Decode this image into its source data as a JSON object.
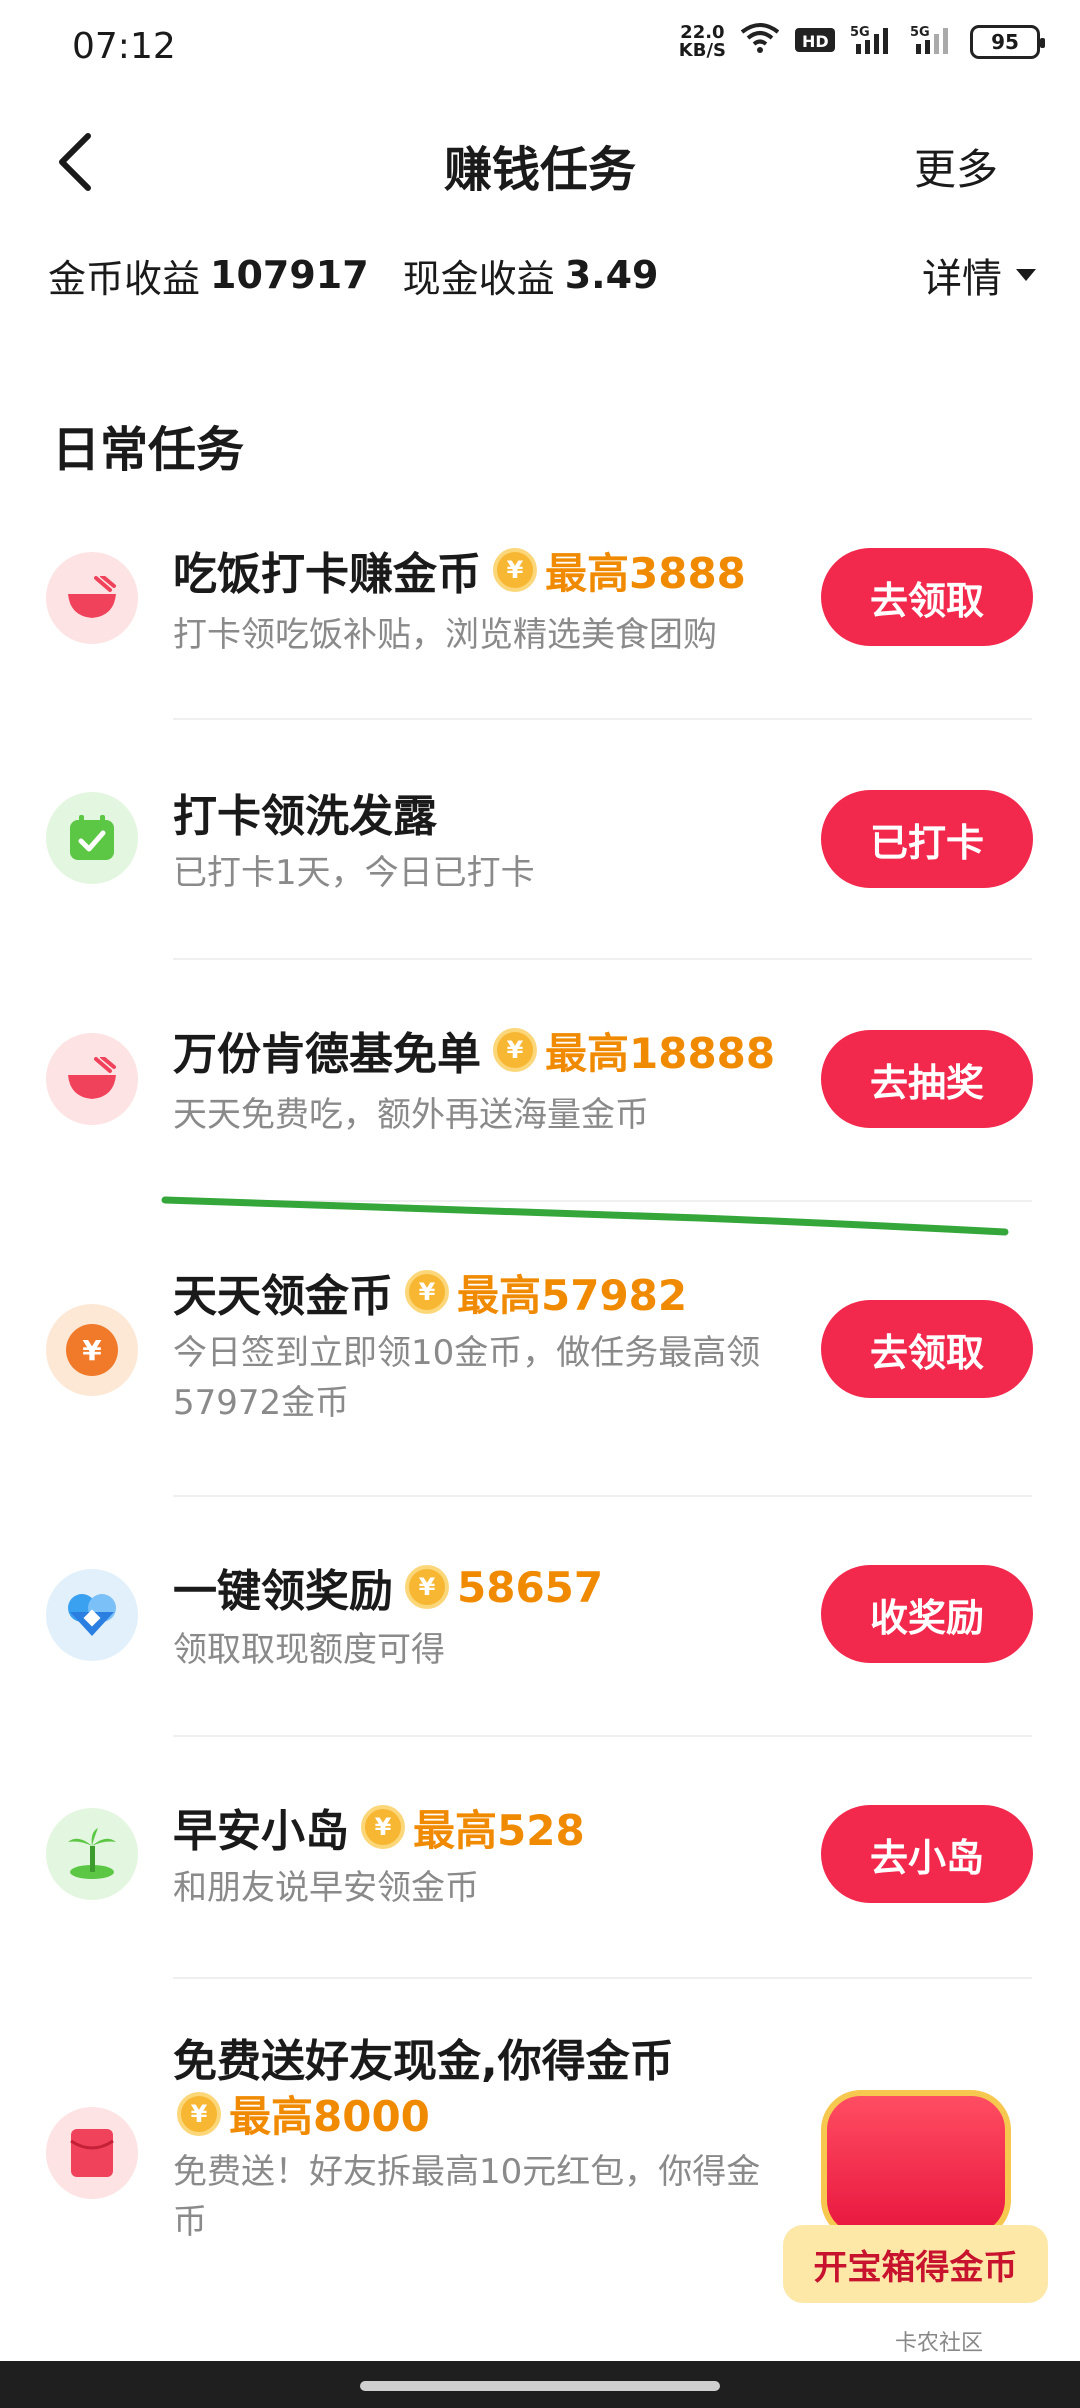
{
  "status_bar": {
    "time": "07:12",
    "net_speed_value": "22.0",
    "net_speed_unit": "KB/S",
    "battery": "95"
  },
  "header": {
    "title": "赚钱任务",
    "more": "更多"
  },
  "earnings": {
    "coin_label": "金币收益",
    "coin_value": "107917",
    "cash_label": "现金收益",
    "cash_value": "3.49",
    "detail": "详情"
  },
  "section_title": "日常任务",
  "tasks": [
    {
      "title": "吃饭打卡赚金币",
      "max": "最高3888",
      "desc": "打卡领吃饭补贴，浏览精选美食团购",
      "button": "去领取",
      "icon": "bowl-icon",
      "icon_bg": "#fde3e3"
    },
    {
      "title": "打卡领洗发露",
      "max": "",
      "desc": "已打卡1天，今日已打卡",
      "button": "已打卡",
      "icon": "calendar-check-icon",
      "icon_bg": "#e3f6df"
    },
    {
      "title": "万份肯德基免单",
      "max": "最高18888",
      "desc": "天天免费吃，额外再送海量金币",
      "button": "去抽奖",
      "icon": "bowl-icon",
      "icon_bg": "#fde3e3"
    },
    {
      "title": "天天领金币",
      "max": "最高57982",
      "desc": "今日签到立即领10金币，做任务最高领57972金币",
      "button": "去领取",
      "icon": "yen-coin-icon",
      "icon_bg": "#fde8d6"
    },
    {
      "title": "一键领奖励",
      "max": "58657",
      "desc": "领取取现额度可得",
      "button": "收奖励",
      "icon": "diamond-icon",
      "icon_bg": "#e1f0fb"
    },
    {
      "title": "早安小岛",
      "max": "最高528",
      "desc": "和朋友说早安领金币",
      "button": "去小岛",
      "icon": "palm-island-icon",
      "icon_bg": "#e3f6df"
    },
    {
      "title": "免费送好友现金,你得金币",
      "max": "最高8000",
      "desc": "免费送！好友拆最高10元红包，你得金币",
      "button": "",
      "icon": "red-envelope-icon",
      "icon_bg": "#fde3e3"
    }
  ],
  "coin_symbol": "¥",
  "floating": {
    "chest_label": "开宝箱得金币"
  },
  "watermark": "卡农社区"
}
